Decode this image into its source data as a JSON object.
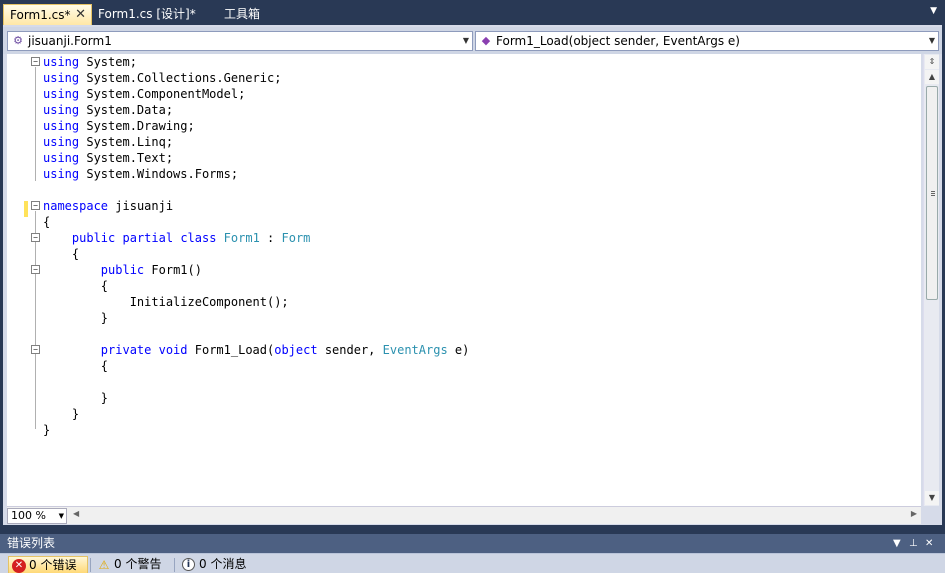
{
  "tabs": [
    {
      "label": "Form1.cs*",
      "active": true,
      "close": "✕"
    },
    {
      "label": "Form1.cs [设计]*",
      "active": false
    },
    {
      "label": "工具箱",
      "active": false
    }
  ],
  "navbar": {
    "class_combo": "jisuanji.Form1",
    "member_combo": "Form1_Load(object sender, EventArgs e)"
  },
  "code": {
    "using_lines": [
      "System;",
      "System.Collections.Generic;",
      "System.ComponentModel;",
      "System.Data;",
      "System.Drawing;",
      "System.Linq;",
      "System.Text;",
      "System.Windows.Forms;"
    ],
    "kw_using": "using",
    "kw_namespace": "namespace",
    "namespace_name": "jisuanji",
    "open_brace": "{",
    "close_brace": "}",
    "kw_public": "public",
    "kw_partial": "partial",
    "kw_class": "class",
    "class_name": "Form1",
    "colon": ":",
    "base_class": "Form",
    "ctor": "Form1()",
    "init_call": "InitializeComponent();",
    "kw_private": "private",
    "kw_void": "void",
    "method_name": "Form1_Load(",
    "kw_object": "object",
    "param_sender": "sender,",
    "type_eventargs": "EventArgs",
    "param_e": "e)"
  },
  "zoom": "100 %",
  "error_list": {
    "title": "错误列表",
    "errors": "0 个错误",
    "warnings": "0 个警告",
    "messages": "0 个消息"
  },
  "colors": {
    "keyword": "#0000ff",
    "type": "#2b91af",
    "chrome": "#293955",
    "active_tab": "#ffe8a6"
  }
}
